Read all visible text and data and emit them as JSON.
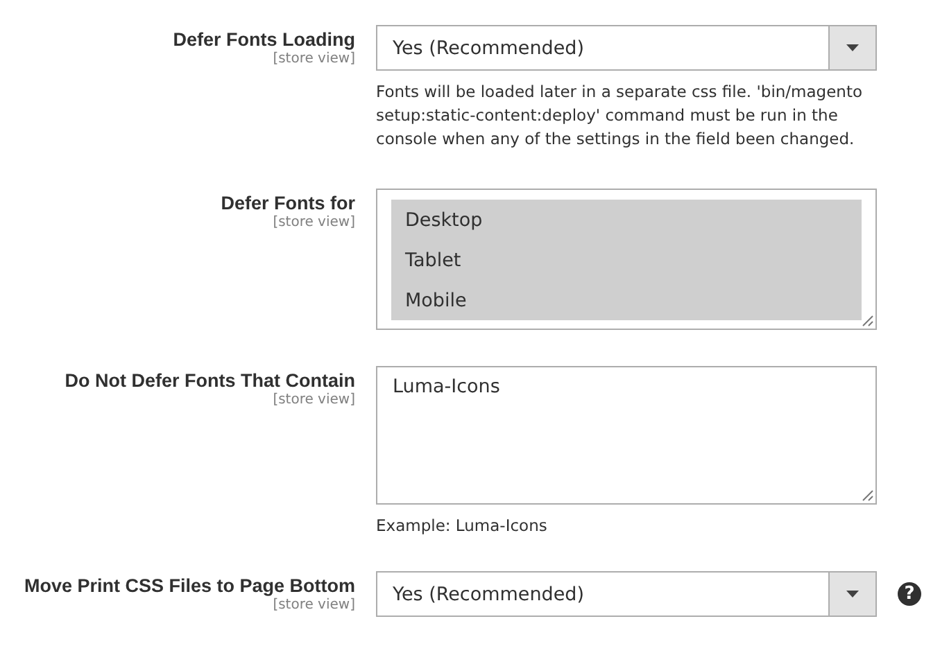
{
  "fields": [
    {
      "kind": "select",
      "label": "Defer Fonts Loading",
      "scope": "[store view]",
      "value": "Yes (Recommended)",
      "note": "Fonts will be loaded later in a separate css file. 'bin/magento setup:static-content:deploy' command must be run in the console when any of the settings in the field been changed."
    },
    {
      "kind": "multiselect",
      "label": "Defer Fonts for",
      "scope": "[store view]",
      "options": [
        {
          "label": "Desktop",
          "selected": true
        },
        {
          "label": "Tablet",
          "selected": true
        },
        {
          "label": "Mobile",
          "selected": true
        }
      ]
    },
    {
      "kind": "textarea",
      "label": "Do Not Defer Fonts That Contain",
      "scope": "[store view]",
      "value": "Luma-Icons",
      "note": "Example: Luma-Icons"
    },
    {
      "kind": "select",
      "label": "Move Print CSS Files to Page Bottom",
      "scope": "[store view]",
      "value": "Yes (Recommended)",
      "help": "?"
    }
  ]
}
